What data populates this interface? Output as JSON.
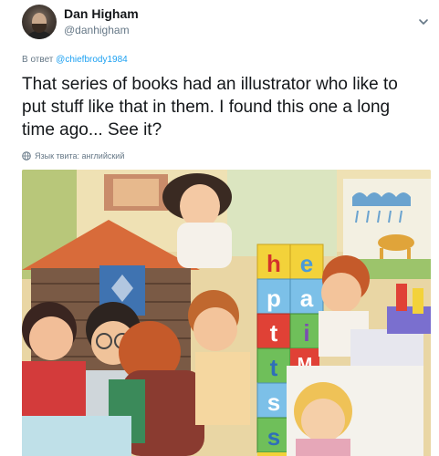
{
  "author": {
    "display_name": "Dan Higham",
    "handle": "@danhigham"
  },
  "reply": {
    "prefix": "В ответ",
    "mention": "@chiefbrody1984"
  },
  "tweet": {
    "text": "That series of books had an illustrator who like to put stuff like that in them. I found this one a long time ago... See it?",
    "language_note": "Язык твита: английский"
  },
  "illustration": {
    "blocks": [
      "h",
      "e",
      "p",
      "a",
      "t",
      "i",
      "t",
      "s",
      "s",
      "M"
    ]
  },
  "colors": {
    "name": "#14171a",
    "secondary": "#657786",
    "link": "#1da1f2"
  },
  "icons": {
    "menu": "chevron-down-icon",
    "language": "globe-icon"
  }
}
